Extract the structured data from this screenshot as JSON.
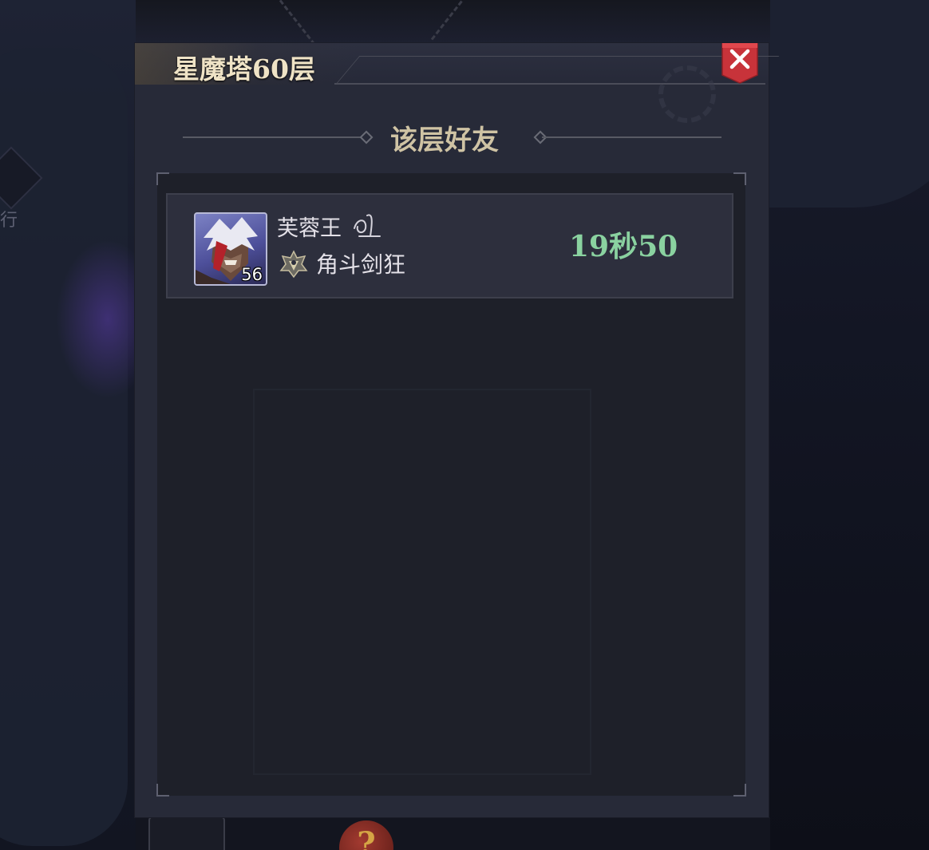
{
  "window": {
    "title": "星魔塔60层",
    "close_icon": "close-icon"
  },
  "section": {
    "title": "该层好友"
  },
  "friends": [
    {
      "name": "芙蓉王",
      "level": "56",
      "class_name": "角斗剑狂",
      "class_icon": "class-emblem-icon",
      "time": "19秒50"
    }
  ],
  "background": {
    "side_label": "行",
    "bottom_orb_symbol": "?"
  },
  "colors": {
    "panel": "#272a38",
    "title_text": "#efe3c6",
    "section_title": "#cfc3a4",
    "time_text": "#8ad2a0",
    "close_button": "#c8333a"
  }
}
